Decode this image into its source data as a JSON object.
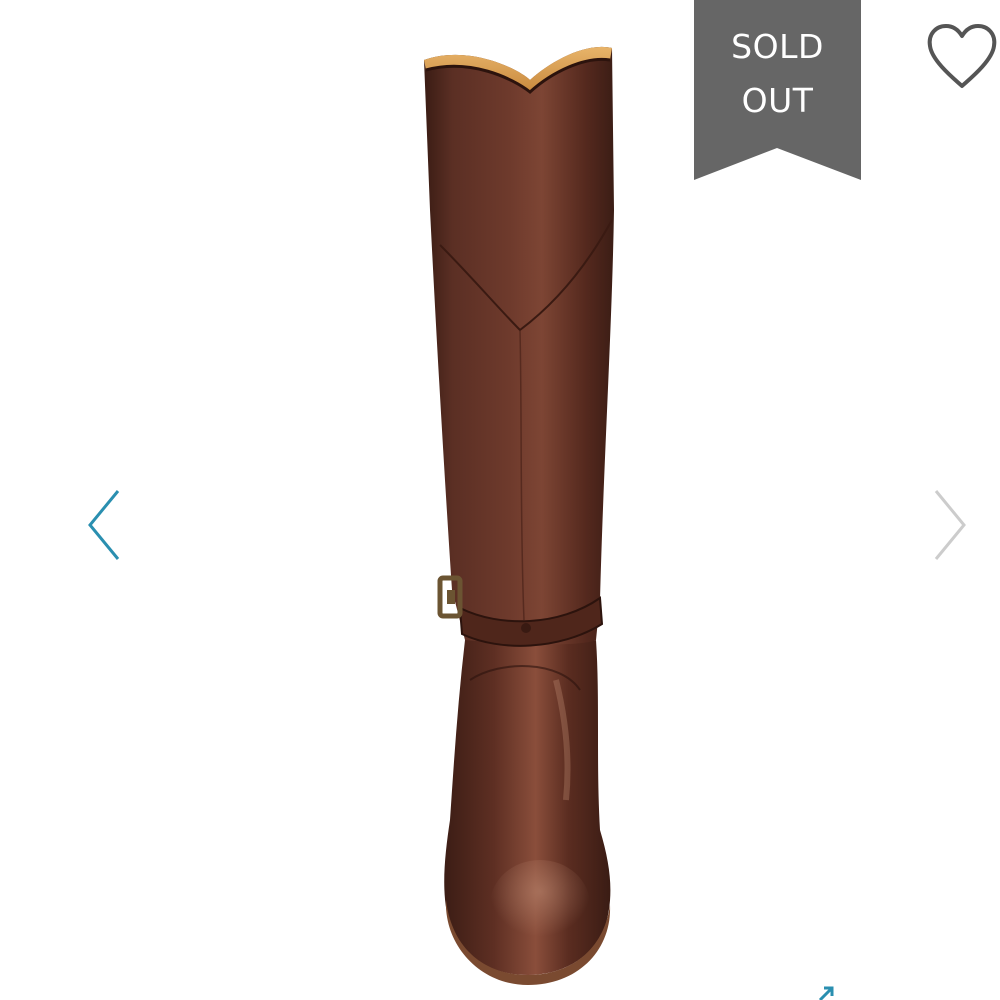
{
  "product": {
    "image": "brown-leather-riding-boot",
    "image_alt": ""
  },
  "badge": {
    "line1": "SOLD",
    "line2": "OUT",
    "color": "#666666"
  },
  "icons": {
    "wishlist": "heart-outline-icon",
    "previous": "chevron-left-icon",
    "next": "chevron-right-icon",
    "expand": "expand-arrow-icon"
  },
  "colors": {
    "accent": "#2a8fb0",
    "arrow_disabled": "#cccccc",
    "boot_leather": "#5a2e22"
  }
}
